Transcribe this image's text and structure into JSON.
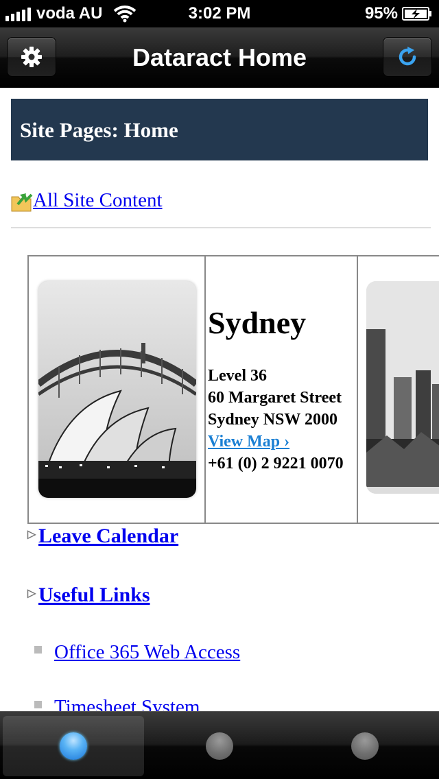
{
  "status": {
    "carrier": "voda AU",
    "time": "3:02 PM",
    "battery": "95%"
  },
  "nav": {
    "title": "Dataract Home",
    "left_icon": "gear-icon",
    "right_icon": "refresh-icon"
  },
  "page": {
    "header": "Site Pages: Home",
    "all_site_content": "All Site Content"
  },
  "office": {
    "city": "Sydney",
    "address_line1": "Level 36",
    "address_line2": "60 Margaret Street",
    "address_line3": "Sydney NSW 2000",
    "view_map": "View Map ›",
    "phone": "+61 (0) 2 9221 0070"
  },
  "sections": {
    "leave_calendar": "Leave Calendar",
    "useful_links": "Useful Links"
  },
  "links": [
    {
      "label": "Office 365 Web Access"
    },
    {
      "label": "Timesheet System"
    }
  ],
  "colors": {
    "header_bg": "#23384f",
    "link": "#0000ee",
    "map_link": "#1a7fd3",
    "active_tab": "#1a75d8"
  }
}
